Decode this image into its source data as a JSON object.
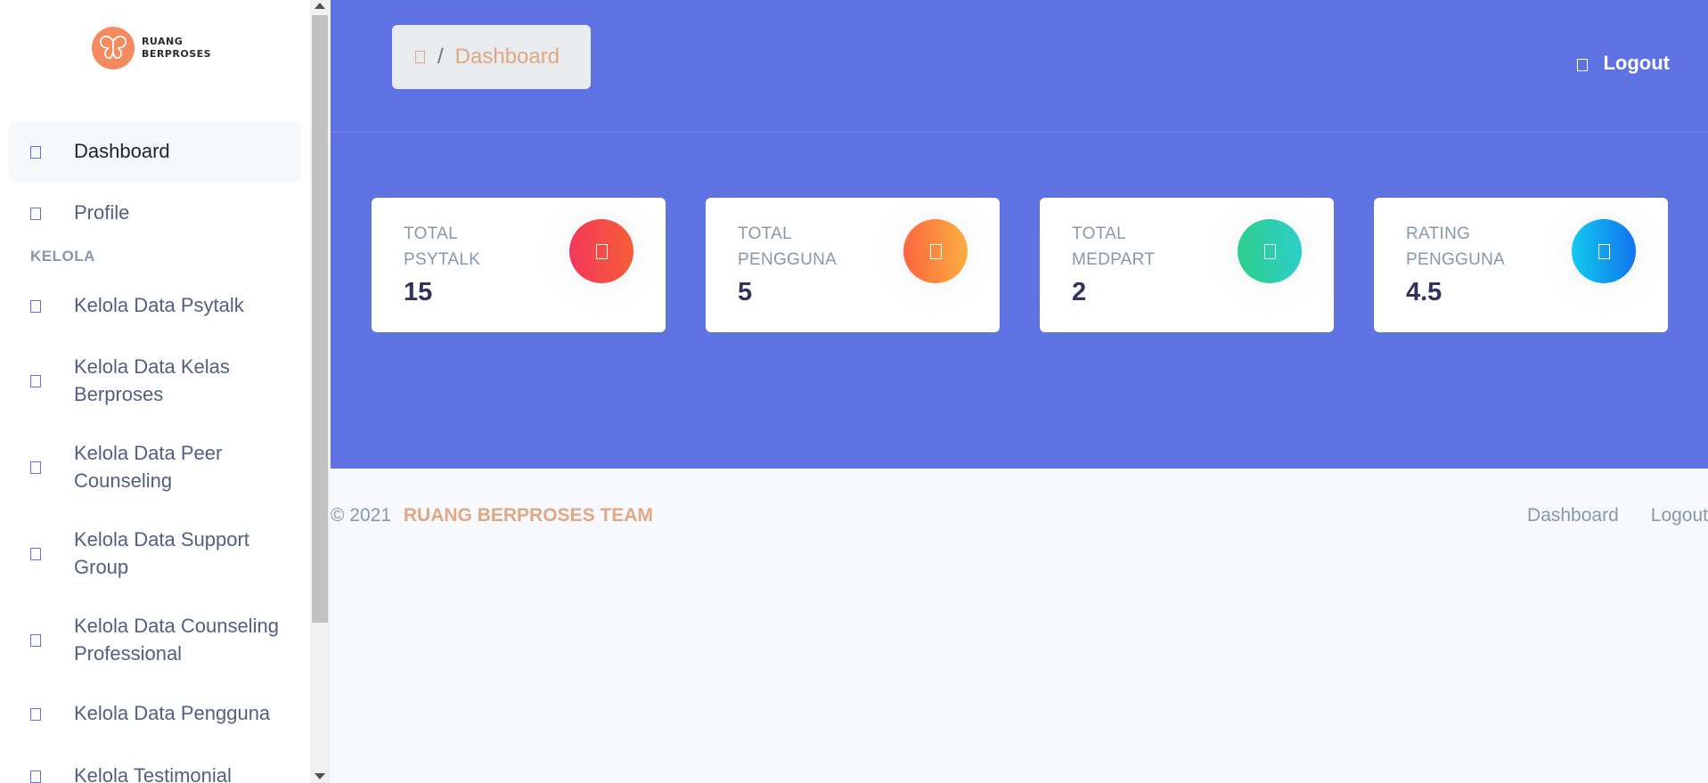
{
  "brand": {
    "line1": "RUANG",
    "line2": "BERPROSES",
    "color": "#f58a5e"
  },
  "sidebar": {
    "items": [
      {
        "label": "Dashboard",
        "icon": "tv-icon",
        "active": true
      },
      {
        "label": "Profile",
        "icon": "user-icon"
      }
    ],
    "heading": "KELOLA",
    "manage_items": [
      {
        "label": "Kelola Data Psytalk",
        "icon": "chat-icon"
      },
      {
        "label": "Kelola Data Kelas Berproses",
        "icon": "class-icon"
      },
      {
        "label": "Kelola Data Peer Counseling",
        "icon": "peer-icon"
      },
      {
        "label": "Kelola Data Support Group",
        "icon": "group-icon"
      },
      {
        "label": "Kelola Data Counseling Professional",
        "icon": "professional-icon"
      },
      {
        "label": "Kelola Data Pengguna",
        "icon": "users-icon"
      },
      {
        "label": "Kelola Testimonial",
        "icon": "testimonial-icon"
      }
    ]
  },
  "header": {
    "breadcrumb": {
      "separator": "/",
      "current": "Dashboard"
    },
    "logout_label": "Logout",
    "background": "#5e72e4"
  },
  "stats": [
    {
      "title": "TOTAL PSYTALK",
      "value": "15",
      "icon": "chat-icon",
      "color": "red"
    },
    {
      "title": "TOTAL PENGGUNA",
      "value": "5",
      "icon": "users-icon",
      "color": "orange"
    },
    {
      "title": "TOTAL MEDPART",
      "value": "2",
      "icon": "partner-icon",
      "color": "green"
    },
    {
      "title": "RATING PENGGUNA",
      "value": "4.5",
      "icon": "star-icon",
      "color": "blue"
    }
  ],
  "footer": {
    "copyright": "© 2021",
    "team": "RUANG BERPROSES TEAM",
    "links": [
      "Dashboard",
      "Logout"
    ]
  }
}
